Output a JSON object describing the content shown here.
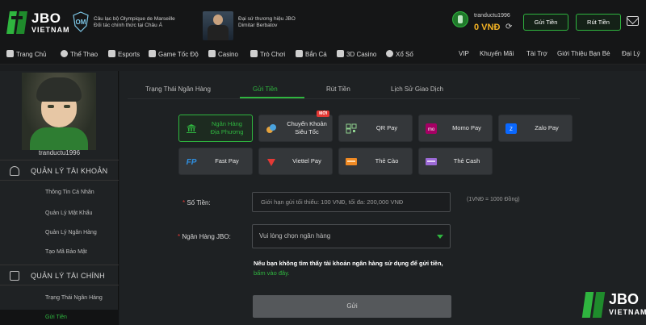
{
  "header": {
    "logo_text": "JBO",
    "logo_sub": "VIETNAM",
    "partner1_line1": "Câu lạc bộ Olympique de Marseille",
    "partner1_line2": "Đối tác chính thức tại Châu Á",
    "partner2_line1": "Đại sứ thương hiệu JBO",
    "partner2_line2": "Dimitar Berbatov",
    "username": "tranductu1996",
    "balance": "0 VNĐ",
    "deposit_label": "Gửi Tiền",
    "withdraw_label": "Rút Tiền"
  },
  "nav": {
    "left": [
      "Trang Chủ",
      "Thể Thao",
      "Esports",
      "Game Tốc Độ",
      "Casino",
      "Trò Chơi",
      "Bắn Cá",
      "3D Casino",
      "Xổ Số"
    ],
    "right": [
      "VIP",
      "Khuyến Mãi",
      "Tài Trợ",
      "Giới Thiệu Bạn Bè",
      "Đại Lý"
    ]
  },
  "sidebar": {
    "username": "tranductu1996",
    "account_section": "QUẢN LÝ TÀI KHOẢN",
    "account_items": [
      "Thông Tin Cá Nhân",
      "Quản Lý Mật Khẩu",
      "Quản Lý Ngân Hàng",
      "Tạo Mã Bảo Mật"
    ],
    "finance_section": "QUẢN LÝ TÀI CHÍNH",
    "finance_items": [
      "Trạng Thái Ngân Hàng",
      "Gửi Tiền"
    ]
  },
  "tabs": [
    "Trạng Thái Ngân Hàng",
    "Gửi Tiền",
    "Rút Tiền",
    "Lịch Sử Giao Dịch"
  ],
  "methods": [
    {
      "label": "Ngân Hàng\nĐịa Phương",
      "active": true,
      "icon": "bank-icon"
    },
    {
      "label": "Chuyển Khoản\nSiêu Tốc",
      "badge": "MỚI",
      "icon": "coin-icon"
    },
    {
      "label": "QR Pay",
      "icon": "qr-icon"
    },
    {
      "label": "Momo Pay",
      "icon": "momo-icon"
    },
    {
      "label": "Zalo Pay",
      "icon": "zalo-icon"
    },
    {
      "label": "Fast Pay",
      "icon": "fastpay-icon"
    },
    {
      "label": "Viettel Pay",
      "icon": "viettel-icon"
    },
    {
      "label": "Thẻ Cào",
      "icon": "card-icon"
    },
    {
      "label": "Thẻ Cash",
      "icon": "cash-card-icon"
    }
  ],
  "form": {
    "amount_label": "Số Tiền:",
    "amount_placeholder": "Giới hạn gửi tối thiểu: 100 VNĐ, tối đa: 200,000 VNĐ",
    "rate_note": "(1VNĐ = 1000 Đồng)",
    "bank_label": "Ngân Hàng JBO:",
    "bank_placeholder": "Vui lòng chọn ngân hàng",
    "hint": "Nếu bạn không tìm thấy tài khoản ngân hàng sử dụng để gửi tiền,",
    "hint_link": "bấm vào đây.",
    "submit": "Gửi"
  },
  "colors": {
    "accent": "#2fb53f",
    "gold": "#f4b324",
    "badge": "#e53935"
  }
}
